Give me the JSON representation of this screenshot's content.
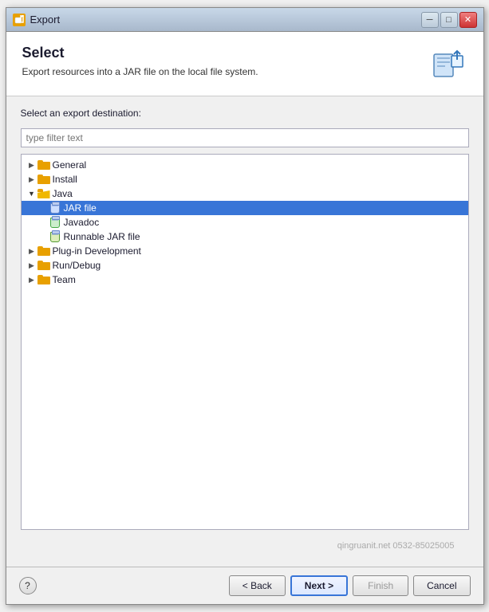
{
  "window": {
    "title": "Export",
    "icon": "export-icon"
  },
  "header": {
    "title": "Select",
    "subtitle": "Export resources into a JAR file on the local file system.",
    "icon_label": "export-icon"
  },
  "filter": {
    "placeholder": "type filter text"
  },
  "destination_label": "Select an export destination:",
  "tree": {
    "items": [
      {
        "id": "general",
        "label": "General",
        "level": 1,
        "type": "folder",
        "expanded": false,
        "selected": false
      },
      {
        "id": "install",
        "label": "Install",
        "level": 1,
        "type": "folder",
        "expanded": false,
        "selected": false
      },
      {
        "id": "java",
        "label": "Java",
        "level": 1,
        "type": "folder",
        "expanded": true,
        "selected": false
      },
      {
        "id": "jar-file",
        "label": "JAR file",
        "level": 2,
        "type": "jar",
        "expanded": false,
        "selected": true
      },
      {
        "id": "javadoc",
        "label": "Javadoc",
        "level": 2,
        "type": "javadoc",
        "expanded": false,
        "selected": false
      },
      {
        "id": "runnable-jar",
        "label": "Runnable JAR file",
        "level": 2,
        "type": "runnable-jar",
        "expanded": false,
        "selected": false
      },
      {
        "id": "plugin-dev",
        "label": "Plug-in Development",
        "level": 1,
        "type": "folder",
        "expanded": false,
        "selected": false
      },
      {
        "id": "run-debug",
        "label": "Run/Debug",
        "level": 1,
        "type": "folder",
        "expanded": false,
        "selected": false
      },
      {
        "id": "team",
        "label": "Team",
        "level": 1,
        "type": "folder",
        "expanded": false,
        "selected": false
      }
    ]
  },
  "watermark": "qingruanit.net 0532-85025005",
  "footer": {
    "help_label": "?",
    "back_label": "< Back",
    "next_label": "Next >",
    "finish_label": "Finish",
    "cancel_label": "Cancel"
  },
  "title_buttons": {
    "minimize": "─",
    "maximize": "□",
    "close": "✕"
  }
}
